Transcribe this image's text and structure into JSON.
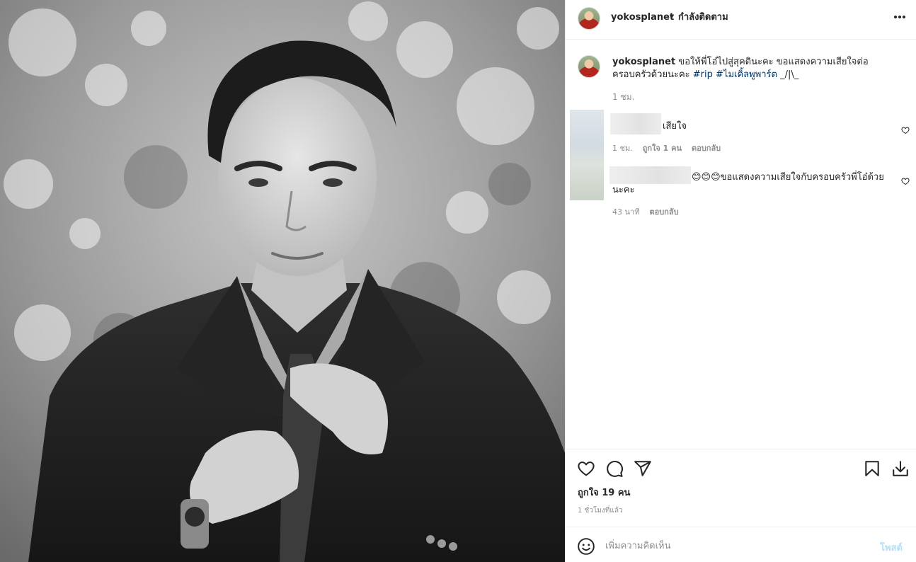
{
  "header": {
    "username": "yokosplanet",
    "separator": "•",
    "follow_status": "กำลังติดตาม"
  },
  "caption": {
    "username": "yokosplanet",
    "text": "ขอให้พี่โอ๋ไปสู่สุคตินะคะ ขอแสดงความเสียใจต่อครอบครัวด้วยนะคะ",
    "hashtags": [
      "#rip",
      "#ไมเคิ้ลพูพาร์ต"
    ],
    "suffix": "_/|\\_",
    "time": "1 ชม."
  },
  "comments": [
    {
      "text": "เสียใจ",
      "time": "1 ชม.",
      "likes": "ถูกใจ 1 คน",
      "reply": "ตอบกลับ"
    },
    {
      "text": "😊😊😊ขอแสดงความเสียใจกับครอบครัวพี่โอ๋ด้วยนะคะ",
      "time": "43 นาที",
      "reply": "ตอบกลับ"
    }
  ],
  "actions": {
    "icons": [
      "heart-icon",
      "comment-icon",
      "share-icon",
      "bookmark-icon",
      "download-icon"
    ]
  },
  "likes_count": "ถูกใจ 19 คน",
  "posted_time": "1 ชั่วโมงที่แล้ว",
  "add_comment": {
    "placeholder": "เพิ่มความคิดเห็น",
    "post_label": "โพสต์"
  },
  "colors": {
    "link": "#00376b",
    "muted": "#8e8e8e",
    "post_disabled": "#b2dffc",
    "border": "#efefef"
  }
}
